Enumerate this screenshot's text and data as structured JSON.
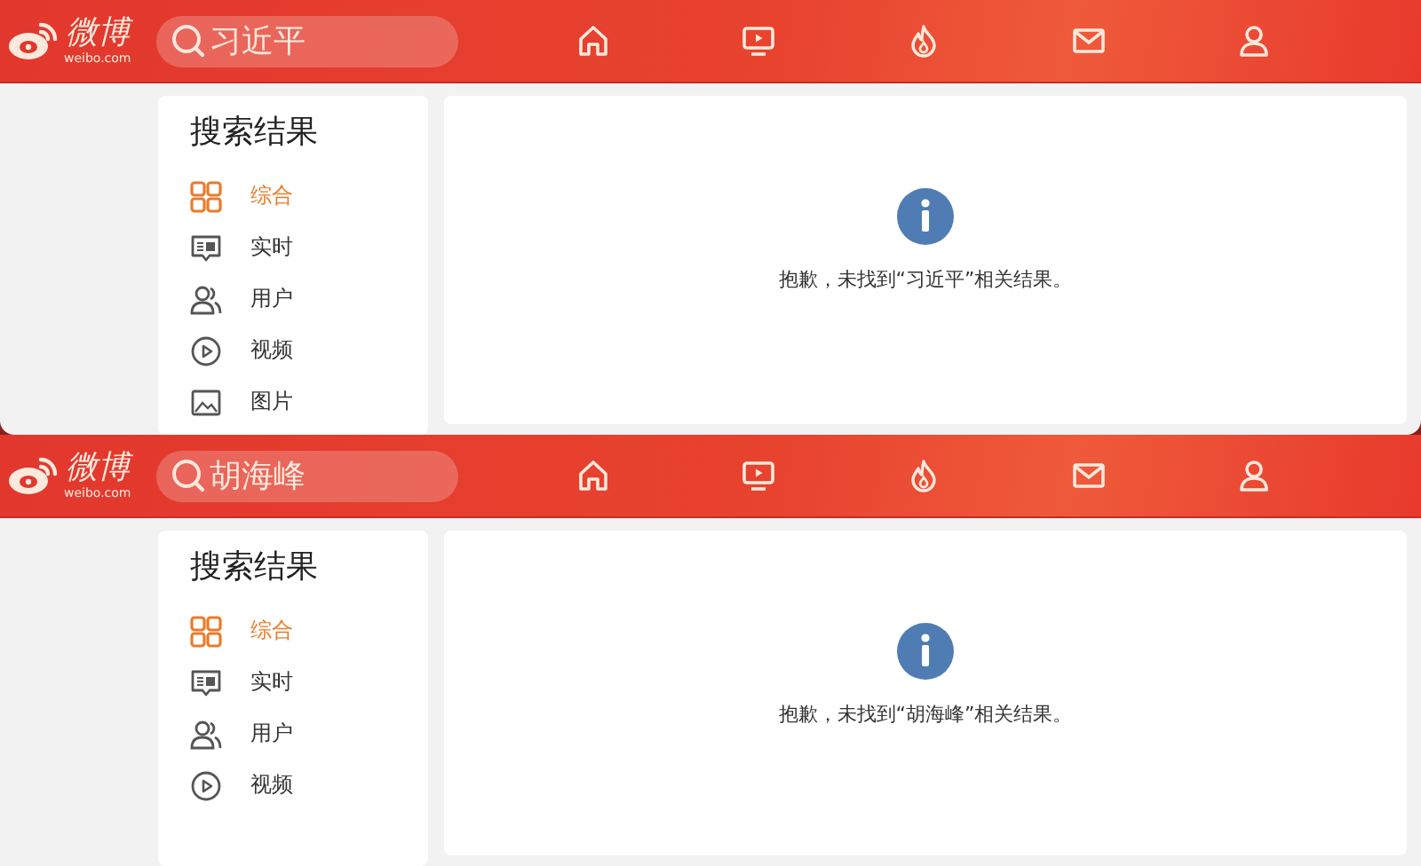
{
  "panels": [
    {
      "logo_text": "微博",
      "logo_domain": "weibo.com",
      "search_query": "习近平",
      "sidebar_title": "搜索结果",
      "nav_icons": [
        {
          "kind": "home"
        },
        {
          "kind": "tv"
        },
        {
          "kind": "fire"
        },
        {
          "kind": "mail"
        },
        {
          "kind": "user"
        }
      ],
      "items": [
        {
          "kind": "grid",
          "label": "综合",
          "selected": true
        },
        {
          "kind": "chat",
          "label": "实时",
          "selected": false
        },
        {
          "kind": "users",
          "label": "用户",
          "selected": false
        },
        {
          "kind": "play",
          "label": "视频",
          "selected": false
        },
        {
          "kind": "image",
          "label": "图片",
          "selected": false
        }
      ],
      "message": "抱歉，未找到“习近平”相关结果。"
    },
    {
      "logo_text": "微博",
      "logo_domain": "weibo.com",
      "search_query": "胡海峰",
      "sidebar_title": "搜索结果",
      "nav_icons": [
        {
          "kind": "home"
        },
        {
          "kind": "tv"
        },
        {
          "kind": "fire"
        },
        {
          "kind": "mail"
        },
        {
          "kind": "user"
        }
      ],
      "items": [
        {
          "kind": "grid",
          "label": "综合",
          "selected": true
        },
        {
          "kind": "chat",
          "label": "实时",
          "selected": false
        },
        {
          "kind": "users",
          "label": "用户",
          "selected": false
        },
        {
          "kind": "play",
          "label": "视频",
          "selected": false
        }
      ],
      "message": "抱歉，未找到“胡海峰”相关结果。"
    }
  ]
}
